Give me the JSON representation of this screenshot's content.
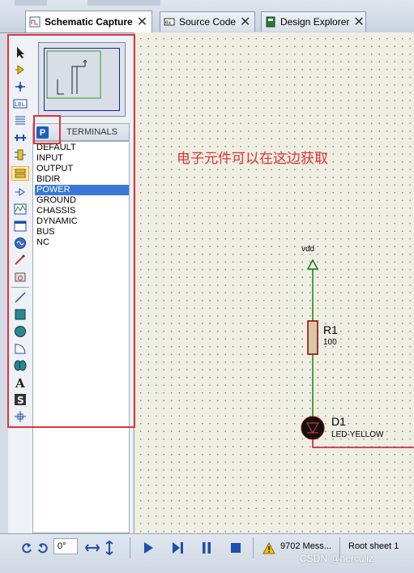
{
  "tabs": [
    {
      "label": "Schematic Capture",
      "active": true
    },
    {
      "label": "Source Code",
      "active": false
    },
    {
      "label": "Design Explorer",
      "active": false
    }
  ],
  "panel": {
    "mode_button": "P",
    "title": "TERMINALS",
    "items": [
      "DEFAULT",
      "INPUT",
      "OUTPUT",
      "BIDIR",
      "POWER",
      "GROUND",
      "CHASSIS",
      "DYNAMIC",
      "BUS",
      "NC"
    ],
    "selected": "POWER"
  },
  "annotation": "电子元件可以在这边获取",
  "schematic": {
    "power_label": "vdd",
    "resistor_ref": "R1",
    "resistor_value": "100",
    "led_ref": "D1",
    "led_value": "LED-YELLOW"
  },
  "bottombar": {
    "rotation_value": "0°",
    "messages": "9702 Mess...",
    "sheet": "Root sheet 1"
  },
  "watermark": "CSDN @herculiz",
  "colors": {
    "highlight": "#e0343a",
    "selection": "#3a78d8",
    "wire": "#1a7a1a",
    "part_outline": "#8b0000"
  }
}
